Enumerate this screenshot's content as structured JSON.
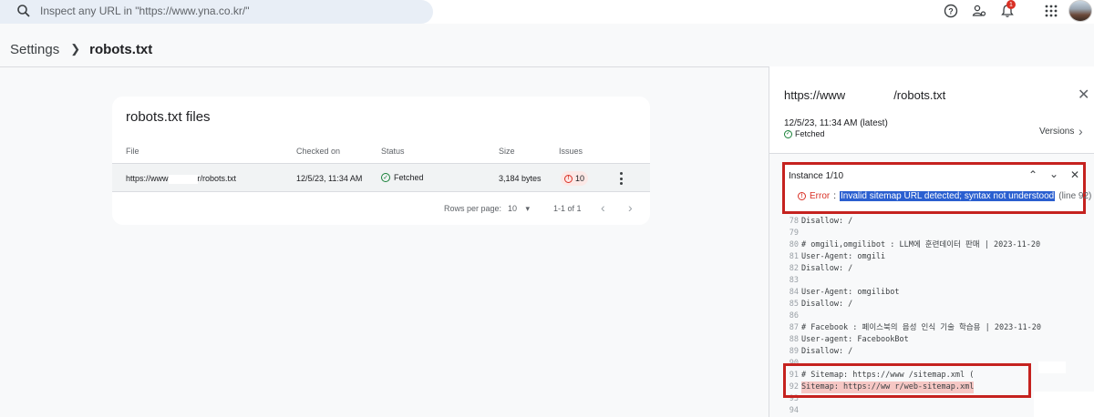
{
  "search": {
    "placeholder": "Inspect any URL in \"https://www.yna.co.kr/\""
  },
  "header": {
    "notification_count": "1"
  },
  "breadcrumb": {
    "parent": "Settings",
    "current": "robots.txt"
  },
  "card": {
    "title": "robots.txt files",
    "columns": [
      "File",
      "Checked on",
      "Status",
      "Size",
      "Issues"
    ],
    "row": {
      "file_prefix": "https://www",
      "file_suffix": "r/robots.txt",
      "checked_on": "12/5/23, 11:34 AM",
      "status": "Fetched",
      "size": "3,184 bytes",
      "issues": "10"
    },
    "pagination": {
      "rows_per_page_label": "Rows per page:",
      "rows_per_page": "10",
      "range": "1-1 of 1"
    }
  },
  "panel": {
    "title_prefix": "https://www",
    "title_suffix": "/robots.txt",
    "fetch_date": "12/5/23, 11:34 AM (latest)",
    "fetch_status": "Fetched",
    "versions_label": "Versions",
    "instance": {
      "label": "Instance 1/10",
      "error_label": "Error",
      "error_sep": ":",
      "error_message": "Invalid sitemap URL detected; syntax not understood",
      "error_line": "(line 92)"
    },
    "code_lines": [
      {
        "num": "78",
        "text": "Disallow: /"
      },
      {
        "num": "79",
        "text": ""
      },
      {
        "num": "80",
        "text": "# omgili,omgilibot : LLM에 훈련데이터 판매 | 2023-11-20"
      },
      {
        "num": "81",
        "text": "User-Agent: omgili"
      },
      {
        "num": "82",
        "text": "Disallow: /"
      },
      {
        "num": "83",
        "text": ""
      },
      {
        "num": "84",
        "text": "User-Agent: omgilibot"
      },
      {
        "num": "85",
        "text": "Disallow: /"
      },
      {
        "num": "86",
        "text": ""
      },
      {
        "num": "87",
        "text": "# Facebook : 페이스북의 음성 인식 기술 학습용 | 2023-11-20"
      },
      {
        "num": "88",
        "text": "User-agent: FacebookBot"
      },
      {
        "num": "89",
        "text": "Disallow: /"
      },
      {
        "num": "90",
        "text": ""
      },
      {
        "num": "91",
        "text": "# Sitemap: https://www           /sitemap.xml ("
      },
      {
        "num": "92",
        "text": "Sitemap: https://ww         r/web-sitemap.xml"
      },
      {
        "num": "93",
        "text": ""
      },
      {
        "num": "94",
        "text": ""
      }
    ]
  }
}
